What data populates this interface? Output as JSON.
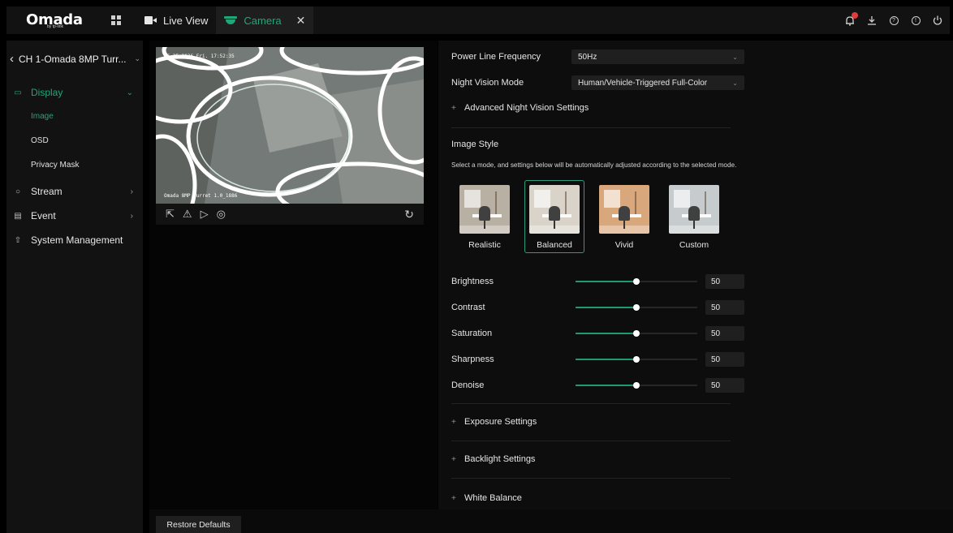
{
  "app": {
    "brand": "Omada",
    "brand_sub": "by tp-link"
  },
  "tabs": [
    {
      "label": "Live View",
      "icon": "video-icon"
    },
    {
      "label": "Camera",
      "icon": "camera-icon",
      "close": "✕"
    }
  ],
  "sidebar": {
    "channel": "CH 1-Omada 8MP Turr...",
    "items": [
      {
        "label": "Display",
        "icon": "monitor-icon",
        "expanded": true
      },
      {
        "label": "Stream",
        "icon": "stream-icon"
      },
      {
        "label": "Event",
        "icon": "event-icon"
      },
      {
        "label": "System Management",
        "icon": "system-icon"
      }
    ],
    "display_sub": [
      "Image",
      "OSD",
      "Privacy Mask"
    ]
  },
  "preview": {
    "timestamp": "06-25-2026 Fri. 17:52:35",
    "camera_name": "Omada 8MP Turret 1.0_1886"
  },
  "settings": {
    "power_line_label": "Power Line Frequency",
    "power_line_value": "50Hz",
    "night_vision_label": "Night Vision Mode",
    "night_vision_value": "Human/Vehicle-Triggered Full-Color",
    "advanced_night": "Advanced Night Vision Settings",
    "image_style_label": "Image Style",
    "image_style_hint": "Select a mode, and settings below will be automatically adjusted according to the selected mode.",
    "styles": [
      "Realistic",
      "Balanced",
      "Vivid",
      "Custom"
    ],
    "selected_style": "Balanced",
    "sliders": [
      {
        "label": "Brightness",
        "value": "50"
      },
      {
        "label": "Contrast",
        "value": "50"
      },
      {
        "label": "Saturation",
        "value": "50"
      },
      {
        "label": "Sharpness",
        "value": "50"
      },
      {
        "label": "Denoise",
        "value": "50"
      }
    ],
    "slider_fill_fraction": 0.5,
    "exposure": "Exposure Settings",
    "backlight": "Backlight Settings",
    "white_balance": "White Balance"
  },
  "footer": {
    "restore": "Restore Defaults"
  },
  "colors": {
    "accent": "#21a67a",
    "notification": "#e23b3b"
  }
}
